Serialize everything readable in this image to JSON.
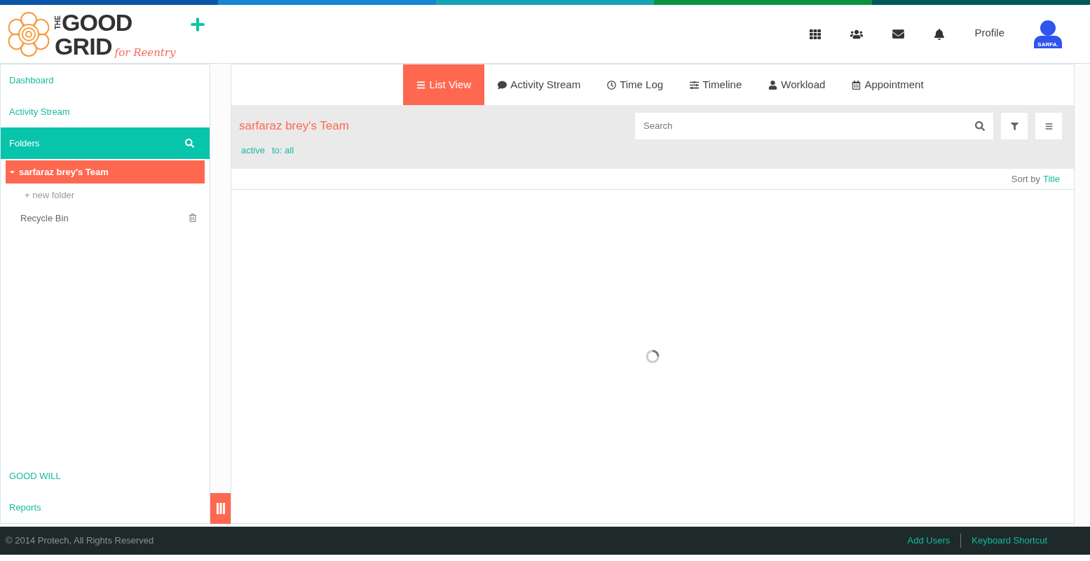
{
  "logo": {
    "line_1_small": "THE",
    "line_1": "GOOD",
    "line_2": "GRID",
    "tagline": "for Reentry"
  },
  "header": {
    "profile_label": "Profile",
    "avatar_caption": "SARFA."
  },
  "sidebar": {
    "top_items": [
      "Dashboard",
      "Activity Stream"
    ],
    "folders": {
      "title": "Folders",
      "tree": [
        {
          "label": "sarfaraz brey's Team",
          "selected": true,
          "expanded": true,
          "children": [
            {
              "label": "+ new folder",
              "kind": "action"
            }
          ]
        }
      ],
      "recycle_bin": "Recycle Bin"
    },
    "bottom_items": [
      "GOOD WILL",
      "Reports"
    ]
  },
  "tabs": [
    {
      "label": "List View",
      "selected": true
    },
    {
      "label": "Activity Stream",
      "selected": false
    },
    {
      "label": "Time Log",
      "selected": false
    },
    {
      "label": "Timeline",
      "selected": false
    },
    {
      "label": "Workload",
      "selected": false
    },
    {
      "label": "Appointment",
      "selected": false
    }
  ],
  "panel": {
    "title": "sarfaraz brey's Team",
    "filters": [
      "active",
      "to: all"
    ],
    "search": {
      "placeholder": "Search"
    },
    "sort_label": "Sort by",
    "sort_value": "Title",
    "loading": true
  },
  "footer": {
    "copyright": "© 2014 Protech, All Rights Reserved",
    "links": [
      "Add Users",
      "Keyboard Shortcut"
    ]
  }
}
